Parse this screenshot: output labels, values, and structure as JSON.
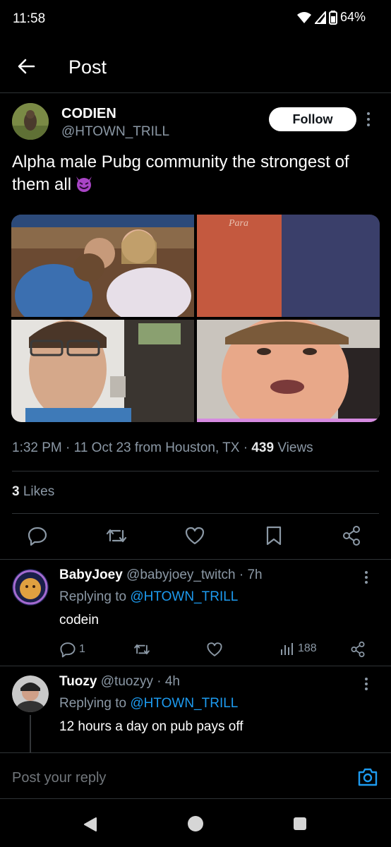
{
  "status_bar": {
    "time": "11:58",
    "battery": "64%"
  },
  "header": {
    "title": "Post"
  },
  "post": {
    "author_name": "CODIEN",
    "author_handle": "@HTOWN_TRILL",
    "follow_label": "Follow",
    "text": "Alpha male Pubg community the strongest of them all",
    "emoji_icon": "smiling-devil-emoji",
    "meta": {
      "time": "1:32 PM",
      "date": "11 Oct 23",
      "location": "from Houston, TX",
      "views_count": "439",
      "views_label": "Views"
    },
    "likes_count": "3",
    "likes_label": "Likes"
  },
  "replies": [
    {
      "name": "BabyJoey",
      "handle": "@babyjoey_twitch",
      "time": "7h",
      "replying_label": "Replying to",
      "replying_handle": "@HTOWN_TRILL",
      "text": "codein",
      "reply_count": "1",
      "views_count": "188"
    },
    {
      "name": "Tuozy",
      "handle": "@tuozyy",
      "time": "4h",
      "replying_label": "Replying to",
      "replying_handle": "@HTOWN_TRILL",
      "text": "12 hours a day on pub pays off"
    }
  ],
  "reply_bar": {
    "placeholder": "Post your reply"
  },
  "colors": {
    "accent": "#1d9bf0",
    "background": "#000000",
    "muted": "#8b98a5"
  }
}
